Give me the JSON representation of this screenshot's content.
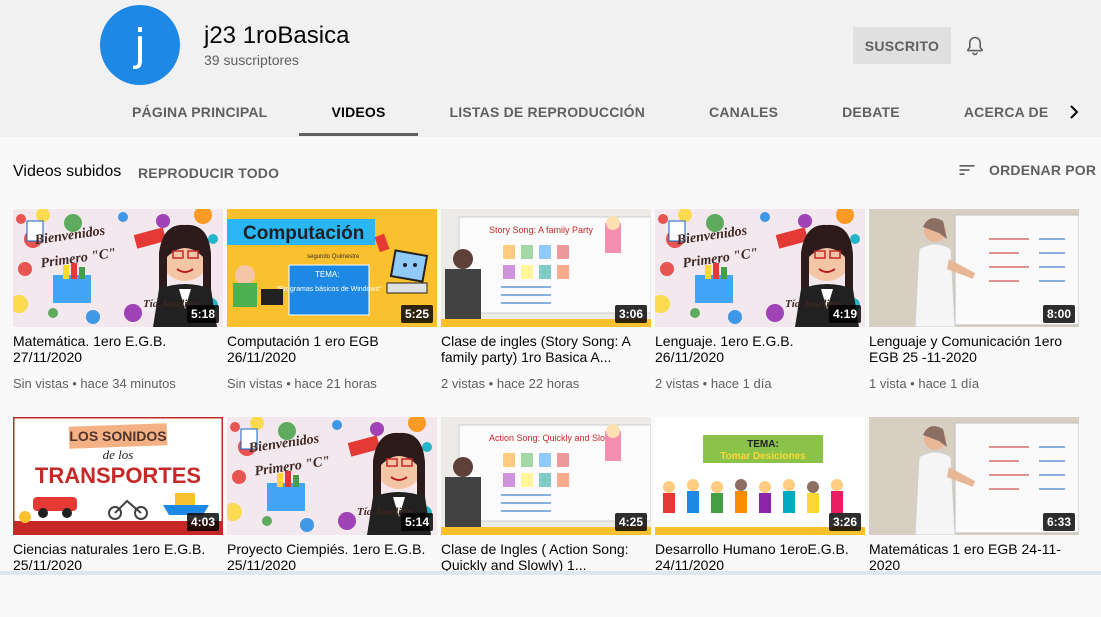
{
  "channel": {
    "avatar_letter": "j",
    "name": "j23 1roBasica",
    "subscribers": "39 suscriptores",
    "subscribe_label": "SUSCRITO"
  },
  "tabs": [
    {
      "label": "PÁGINA PRINCIPAL",
      "active": false
    },
    {
      "label": "VIDEOS",
      "active": true
    },
    {
      "label": "LISTAS DE REPRODUCCIÓN",
      "active": false
    },
    {
      "label": "CANALES",
      "active": false
    },
    {
      "label": "DEBATE",
      "active": false
    },
    {
      "label": "ACERCA DE",
      "active": false
    }
  ],
  "section": {
    "title": "Videos subidos",
    "play_all": "REPRODUCIR TODO",
    "sort_label": "ORDENAR POR"
  },
  "videos": [
    {
      "title": "Matemática. 1ero E.G.B. 27/11/2020",
      "duration": "5:18",
      "meta": "Sin vistas • hace 34 minutos",
      "thumb": {
        "kind": "welcome",
        "text1": "Bienvenidos",
        "text2": "Primero \"C\"",
        "text3": "Tía Joseline"
      }
    },
    {
      "title": "Computación 1 ero EGB 26/11/2020",
      "duration": "5:25",
      "meta": "Sin vistas • hace 21 horas",
      "thumb": {
        "kind": "computacion",
        "text1": "Computación",
        "text2": "segundo Quimestre",
        "text3": "TEMA:",
        "text4": "\"Programas básicos de Windows\""
      }
    },
    {
      "title": "Clase de ingles (Story Song: A family party) 1ro Basica A...",
      "duration": "3:06",
      "meta": "2 vistas • hace 22 horas",
      "thumb": {
        "kind": "whiteboard",
        "text1": "Story Song: A family Party"
      }
    },
    {
      "title": "Lenguaje. 1ero E.G.B. 26/11/2020",
      "duration": "4:19",
      "meta": "2 vistas • hace 1 día",
      "thumb": {
        "kind": "welcome",
        "text1": "Bienvenidos",
        "text2": "Primero \"C\"",
        "text3": "Tía Joseline"
      }
    },
    {
      "title": "Lenguaje y Comunicación 1ero EGB 25 -11-2020",
      "duration": "8:00",
      "meta": "1 vista • hace 1 día",
      "thumb": {
        "kind": "teacher"
      }
    },
    {
      "title": "Ciencias naturales 1ero E.G.B. 25/11/2020",
      "duration": "4:03",
      "meta": "",
      "thumb": {
        "kind": "sonidos",
        "text1": "LOS SONIDOS",
        "text2": "de los",
        "text3": "TRANSPORTES"
      }
    },
    {
      "title": "Proyecto Ciempiés. 1ero E.G.B. 25/11/2020",
      "duration": "5:14",
      "meta": "",
      "thumb": {
        "kind": "welcome",
        "text1": "Bienvenidos",
        "text2": "Primero \"C\"",
        "text3": "Tía Joseline"
      }
    },
    {
      "title": "Clase de Ingles ( Action Song: Quickly and Slowly) 1...",
      "duration": "4:25",
      "meta": "",
      "thumb": {
        "kind": "whiteboard",
        "text1": "Action Song: Quickly and Slowly"
      }
    },
    {
      "title": "Desarrollo Humano 1eroE.G.B. 24/11/2020",
      "duration": "3:26",
      "meta": "",
      "thumb": {
        "kind": "desarrollo",
        "text1": "TEMA:",
        "text2": "Tomar Desiciones"
      }
    },
    {
      "title": "Matemáticas 1 ero EGB 24-11-2020",
      "duration": "6:33",
      "meta": "",
      "thumb": {
        "kind": "teacher"
      }
    }
  ]
}
